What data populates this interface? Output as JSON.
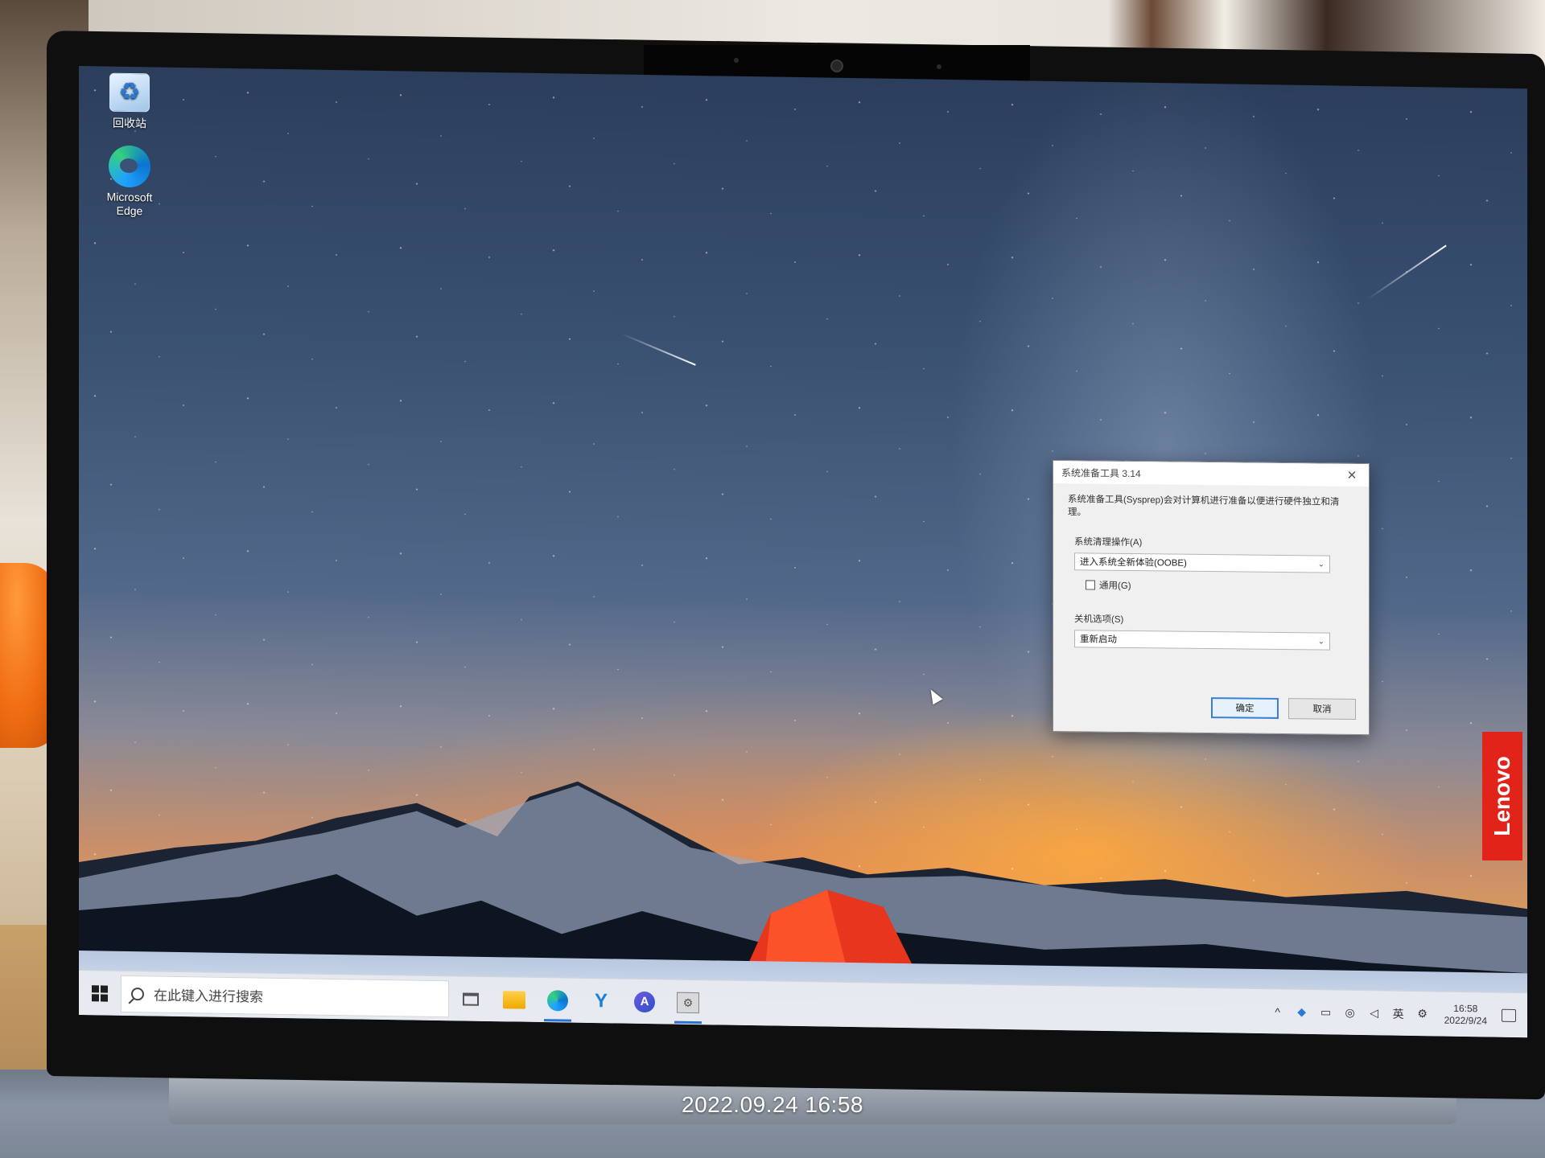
{
  "desktop": {
    "icons": [
      {
        "label": "回收站",
        "icon": "recycle-bin-icon"
      },
      {
        "label": "Microsoft Edge",
        "icon": "edge-icon"
      }
    ]
  },
  "dialog": {
    "title": "系统准备工具 3.14",
    "close_glyph": "✕",
    "description": "系统准备工具(Sysprep)会对计算机进行准备以便进行硬件独立和清理。",
    "cleanup_label": "系统清理操作(A)",
    "cleanup_value": "进入系统全新体验(OOBE)",
    "generalize_label": "通用(G)",
    "generalize_checked": false,
    "shutdown_label": "关机选项(S)",
    "shutdown_value": "重新启动",
    "ok_label": "确定",
    "cancel_label": "取消"
  },
  "taskbar": {
    "search_placeholder": "在此键入进行搜索",
    "apps": [
      "task-view-icon",
      "file-explorer-icon",
      "edge-icon",
      "app-icon",
      "app-icon",
      "sysprep-icon"
    ],
    "tray": {
      "chevron": "^",
      "ime": "英",
      "time": "16:58",
      "date": "2022/9/24"
    }
  },
  "branding": {
    "lenovo": "Lenovo",
    "lenovo_color": "#e2231a"
  },
  "photo_timestamp": "2022.09.24 16:58"
}
